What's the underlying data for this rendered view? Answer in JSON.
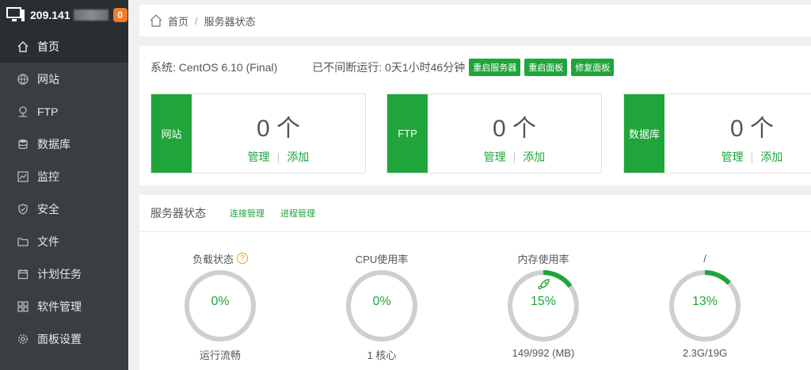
{
  "sidebar": {
    "ip": "209.141",
    "badge": "0",
    "items": [
      {
        "label": "首页",
        "icon": "home-icon",
        "active": true
      },
      {
        "label": "网站",
        "icon": "globe-icon"
      },
      {
        "label": "FTP",
        "icon": "ftp-icon"
      },
      {
        "label": "数据库",
        "icon": "database-icon"
      },
      {
        "label": "监控",
        "icon": "monitor-icon"
      },
      {
        "label": "安全",
        "icon": "shield-icon"
      },
      {
        "label": "文件",
        "icon": "folder-icon"
      },
      {
        "label": "计划任务",
        "icon": "calendar-icon"
      },
      {
        "label": "软件管理",
        "icon": "grid-icon"
      },
      {
        "label": "面板设置",
        "icon": "gear-icon"
      }
    ]
  },
  "breadcrumb": {
    "home": "首页",
    "sep": "/",
    "current": "服务器状态"
  },
  "system": {
    "os": "系统: CentOS 6.10 (Final)",
    "uptime": "已不间断运行: 0天1小时46分钟",
    "buttons": [
      "重启服务器",
      "重启面板",
      "修复面板"
    ]
  },
  "cards": [
    {
      "tag": "网站",
      "count": "0 个",
      "manage": "管理",
      "add": "添加"
    },
    {
      "tag": "FTP",
      "count": "0 个",
      "manage": "管理",
      "add": "添加"
    },
    {
      "tag": "数据库",
      "count": "0 个",
      "manage": "管理",
      "add": "添加"
    }
  ],
  "status": {
    "title": "服务器状态",
    "links": [
      "连接管理",
      "进程管理"
    ],
    "gauges": [
      {
        "title": "负载状态",
        "value": "0%",
        "foot": "运行流畅",
        "percent": 0,
        "help": "?"
      },
      {
        "title": "CPU使用率",
        "value": "0%",
        "foot": "1 核心",
        "percent": 0
      },
      {
        "title": "内存使用率",
        "value": "15%",
        "foot": "149/992 (MB)",
        "percent": 15
      },
      {
        "title": "/",
        "value": "13%",
        "foot": "2.3G/19G",
        "percent": 13
      }
    ]
  },
  "colors": {
    "accent": "#20a53a",
    "sidebar": "#3a3d42",
    "badge": "#f07c28"
  }
}
